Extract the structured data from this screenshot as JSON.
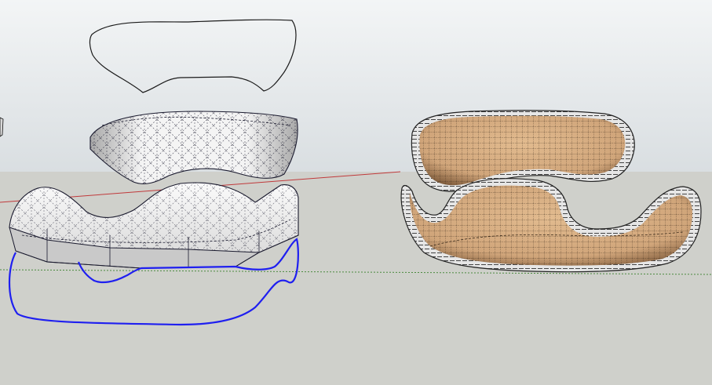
{
  "viewport": {
    "sky_top_color": "#f3f5f6",
    "sky_bottom_color": "#d9dee1",
    "ground_color": "#cfd0cb",
    "red_axis_color": "#c0393b",
    "green_axis_color": "#4b8a3f"
  },
  "models": {
    "outline_curve_color": "#1b1b1b",
    "wire_outline_color": "#1a1a2e",
    "selected_curve_color": "#1f1ff0",
    "shell_light_color": "#f4f4f4",
    "shell_shadow_color": "#a9a9a9",
    "upholstery_color": "#d0a57a",
    "upholstery_shadow_color": "#7e5a3a",
    "trim_color": "#e6e6e6"
  }
}
